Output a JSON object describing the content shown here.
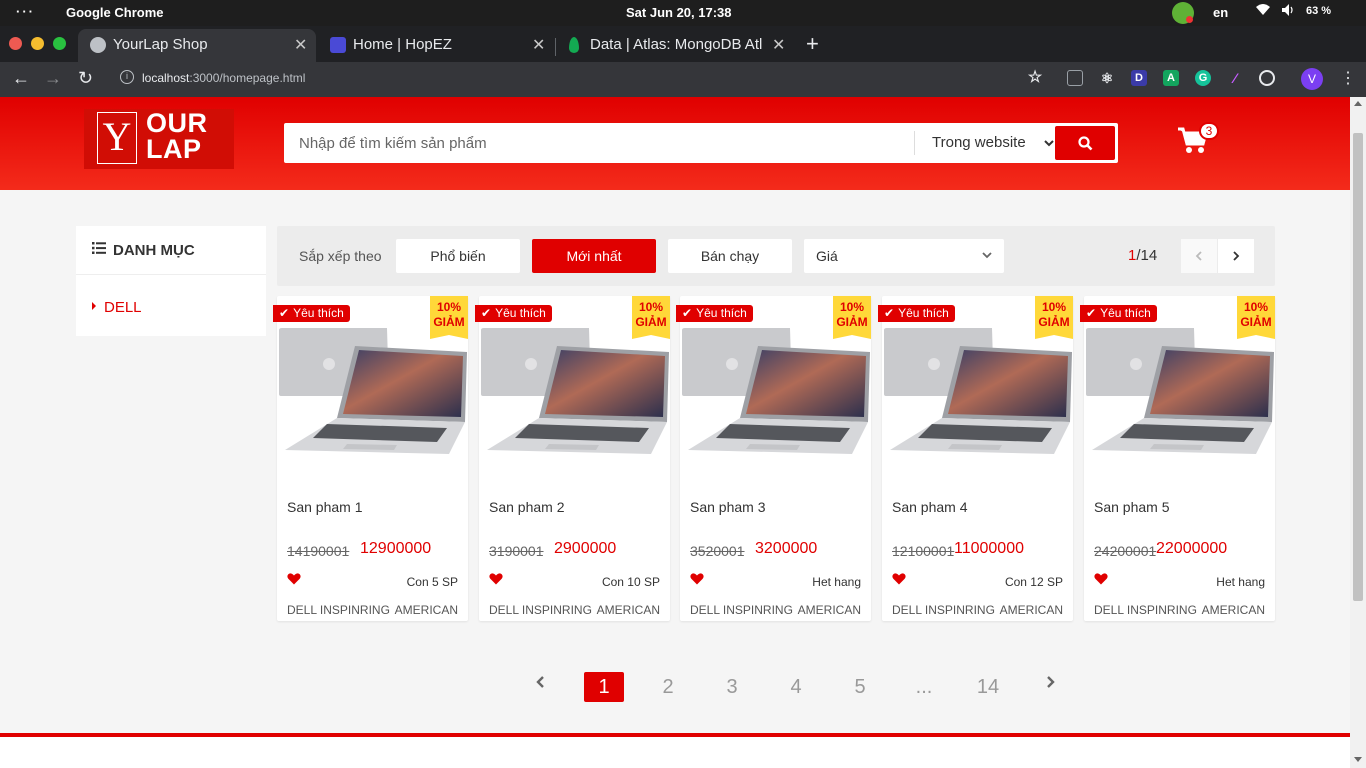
{
  "os": {
    "app_name": "Google Chrome",
    "clock": "Sat Jun 20, 17:38",
    "lang": "en",
    "battery": "63 %"
  },
  "tabs": [
    {
      "title": "YourLap Shop",
      "active": true
    },
    {
      "title": "Home | HopEZ",
      "active": false
    },
    {
      "title": "Data | Atlas: MongoDB Atl",
      "active": false
    }
  ],
  "address": {
    "host": "localhost",
    "path": ":3000/homepage.html"
  },
  "header": {
    "logo_mark": "Y",
    "logo_line1": "OUR",
    "logo_line2": "LAP",
    "search_placeholder": "Nhập để tìm kiếm sản phẩm",
    "search_scope": "Trong website",
    "cart_count": "3"
  },
  "sidebar": {
    "title": "DANH MỤC",
    "items": [
      {
        "label": "DELL"
      }
    ]
  },
  "filter": {
    "label": "Sắp xếp theo",
    "options": [
      "Phổ biến",
      "Mới nhất",
      "Bán chạy"
    ],
    "active_option": "Mới nhất",
    "price_select": "Giá",
    "page_current": "1",
    "page_total": "/14"
  },
  "products": [
    {
      "name": "San pham 1",
      "old_price": "14190001",
      "price": "12900000",
      "stock": "Con 5 SP",
      "brand": "DELL INSPINRING",
      "origin": "AMERICAN",
      "badge": "Yêu thích",
      "sale_pct": "10%",
      "sale_word": "GIẢM"
    },
    {
      "name": "San pham 2",
      "old_price": "3190001",
      "price": "2900000",
      "stock": "Con 10 SP",
      "brand": "DELL INSPINRING",
      "origin": "AMERICAN",
      "badge": "Yêu thích",
      "sale_pct": "10%",
      "sale_word": "GIẢM"
    },
    {
      "name": "San pham 3",
      "old_price": "3520001",
      "price": "3200000",
      "stock": "Het hang",
      "brand": "DELL INSPINRING",
      "origin": "AMERICAN",
      "badge": "Yêu thích",
      "sale_pct": "10%",
      "sale_word": "GIẢM"
    },
    {
      "name": "San pham 4",
      "old_price": "12100001",
      "price": "11000000",
      "stock": "Con 12 SP",
      "brand": "DELL INSPINRING",
      "origin": "AMERICAN",
      "badge": "Yêu thích",
      "sale_pct": "10%",
      "sale_word": "GIẢM"
    },
    {
      "name": "San pham 5",
      "old_price": "24200001",
      "price": "22000000",
      "stock": "Het hang",
      "brand": "DELL INSPINRING",
      "origin": "AMERICAN",
      "badge": "Yêu thích",
      "sale_pct": "10%",
      "sale_word": "GIẢM"
    }
  ],
  "pagination": {
    "pages": [
      "1",
      "2",
      "3",
      "4",
      "5",
      "...",
      "14"
    ],
    "current": "1"
  },
  "colors": {
    "brand_red": "#e00000",
    "sale_yellow": "#ffd839"
  }
}
